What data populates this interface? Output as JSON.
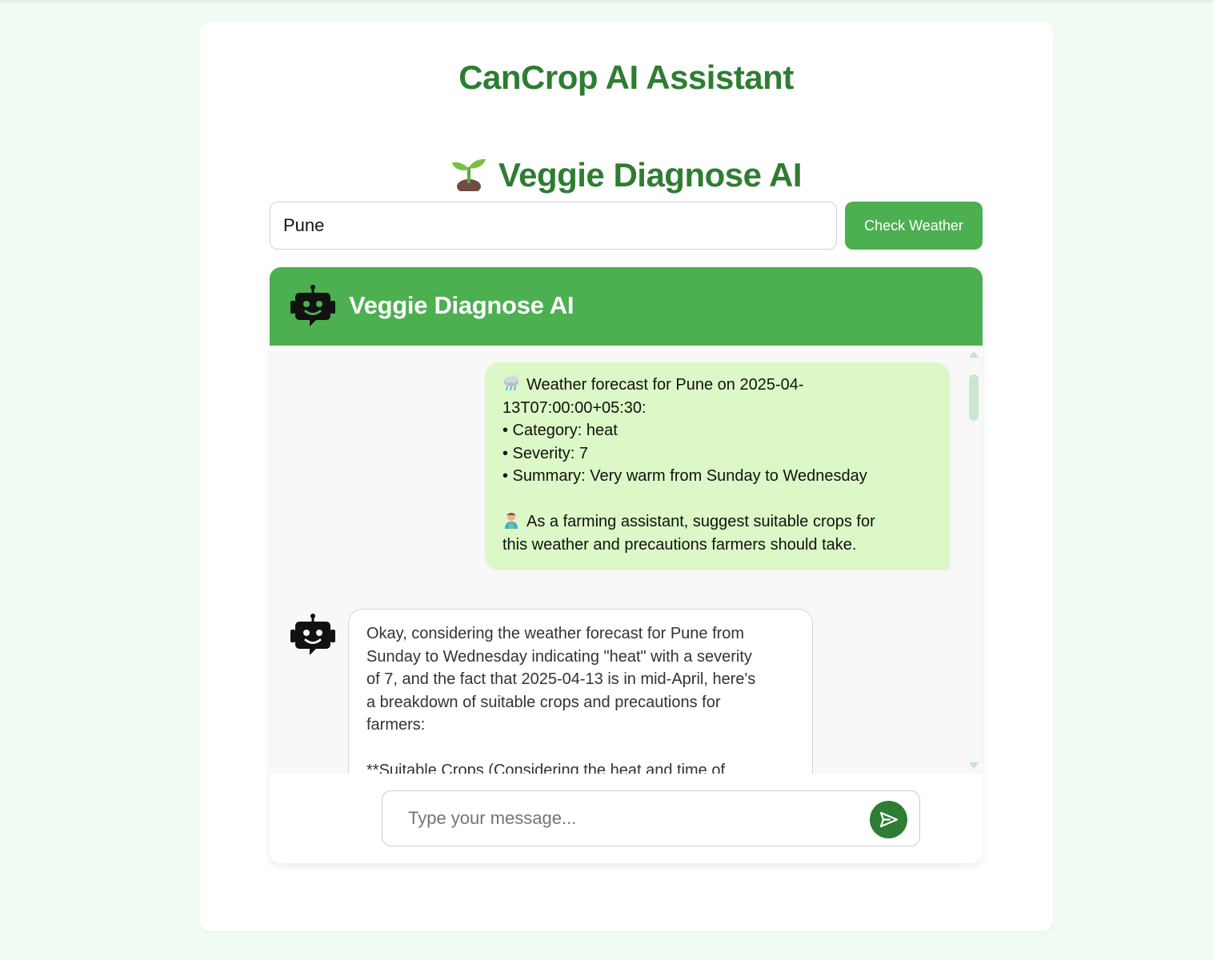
{
  "app": {
    "title": "CanCrop AI Assistant",
    "subtitle": "Veggie Diagnose AI",
    "subtitle_icon": "sprout-icon"
  },
  "weather_search": {
    "city_value": "Pune",
    "button_label": "Check Weather"
  },
  "chat": {
    "header_title": "Veggie Diagnose AI",
    "header_icon": "robot-icon",
    "messages": [
      {
        "role": "user",
        "icon": "cloud-rain-icon",
        "text": "Weather forecast for Pune on 2025-04-\n13T07:00:00+05:30:\n• Category: heat\n• Severity: 7\n• Summary: Very warm from Sunday to Wednesday\n\n",
        "icon2": "farmer-icon",
        "text2": "As a farming assistant, suggest suitable crops for\nthis weather and precautions farmers should take."
      },
      {
        "role": "bot",
        "icon": "robot-icon",
        "text": "Okay, considering the weather forecast for Pune from\nSunday to Wednesday indicating \"heat\" with a severity\nof 7, and the fact that 2025-04-13 is in mid-April, here's\na breakdown of suitable crops and precautions for\nfarmers:\n\n**Suitable Crops (Considering the heat and time of"
      }
    ],
    "input_placeholder": "Type your message...",
    "send_icon": "send-icon"
  },
  "colors": {
    "brand_green": "#2e7d32",
    "accent_green": "#4caf50",
    "user_bubble": "#dcf8c6",
    "page_bg": "#f0fbf1"
  }
}
